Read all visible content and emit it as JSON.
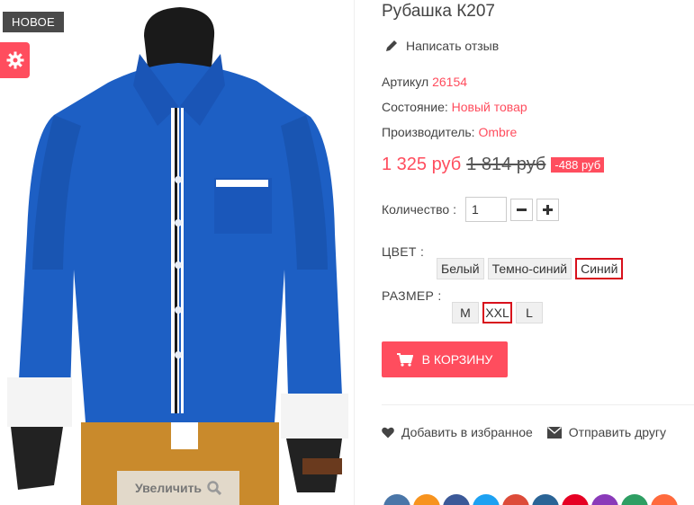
{
  "badge": "НОВОЕ",
  "zoom_label": "Увеличить",
  "product": {
    "title": "Рубашка К207",
    "review_link": "Написать отзыв",
    "article_label": "Артикул",
    "article_value": "26154",
    "condition_label": "Состояние:",
    "condition_value": "Новый товар",
    "manufacturer_label": "Производитель:",
    "manufacturer_value": "Ombre",
    "price": "1 325 руб",
    "old_price": "1 814 руб",
    "discount": "-488 руб",
    "quantity_label": "Количество :",
    "quantity_value": "1",
    "color_label": "ЦВЕТ :",
    "colors": [
      "Белый",
      "Темно-синий",
      "Синий"
    ],
    "selected_color": "Синий",
    "size_label": "РАЗМЕР :",
    "sizes": [
      "M",
      "XXL",
      "L"
    ],
    "selected_size": "XXL",
    "cart_button": "В КОРЗИНУ",
    "wishlist": "Добавить в избранное",
    "send_friend": "Отправить другу"
  },
  "icons": {
    "gear": "gear-icon",
    "zoom": "search-icon",
    "review": "pencil-icon",
    "cart": "cart-icon",
    "heart": "heart-icon",
    "mail": "envelope-icon"
  },
  "colors": {
    "accent": "#ff4d5e",
    "selected_border": "#d8101c",
    "shirt": "#1d5fc4"
  },
  "share_colors": [
    "#4a76a8",
    "#f7931e",
    "#3b5998",
    "#1da1f2",
    "#dd4b39",
    "#2a6496",
    "#e60023",
    "#8a3ab9",
    "#2e9e63",
    "#ff6a3d"
  ]
}
